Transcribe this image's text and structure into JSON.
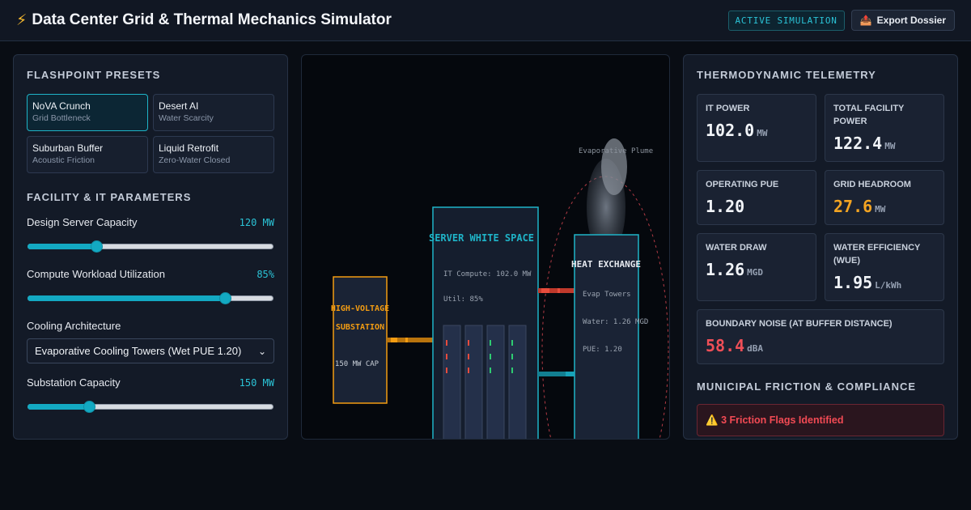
{
  "header": {
    "icon": "lightning-bolt-icon",
    "title": "Data Center Grid & Thermal Mechanics Simulator",
    "badge": "ACTIVE SIMULATION",
    "export_icon": "outbox-tray-icon",
    "export_label": "Export Dossier"
  },
  "left_panel": {
    "presets_title": "FLASHPOINT PRESETS",
    "presets": [
      {
        "name": "NoVA Crunch",
        "sub": "Grid Bottleneck",
        "active": true
      },
      {
        "name": "Desert AI",
        "sub": "Water Scarcity",
        "active": false
      },
      {
        "name": "Suburban Buffer",
        "sub": "Acoustic Friction",
        "active": false
      },
      {
        "name": "Liquid Retrofit",
        "sub": "Zero-Water Closed",
        "active": false
      }
    ],
    "params_title": "FACILITY & IT PARAMETERS",
    "params": {
      "capacity": {
        "label": "Design Server Capacity",
        "value": "120 MW",
        "level": 0.28
      },
      "utilization": {
        "label": "Compute Workload Utilization",
        "value": "85%",
        "level": 0.8
      },
      "cooling": {
        "label": "Cooling Architecture",
        "selected": "Evaporative Cooling Towers (Wet PUE 1.20)"
      },
      "substation": {
        "label": "Substation Capacity",
        "value": "150 MW",
        "level": 0.25
      }
    }
  },
  "diagram": {
    "substation": {
      "title1": "HIGH-VOLTAGE",
      "title2": "SUBSTATION",
      "cap": "150 MW CAP"
    },
    "white_space": {
      "title": "SERVER WHITE SPACE",
      "compute": "IT Compute: 102.0 MW",
      "util": "Util: 85%"
    },
    "heat_exchange": {
      "title": "HEAT EXCHANGE",
      "type": "Evap Towers",
      "water": "Water: 1.26 MGD",
      "pue": "PUE: 1.20"
    },
    "plume_label": "Evaporative Plume",
    "colors": {
      "power": "#f39c12",
      "hot": "#e74c3c",
      "cool": "#17a2b8",
      "frame": "#1fb4c8"
    }
  },
  "right_panel": {
    "telemetry_title": "THERMODYNAMIC TELEMETRY",
    "metrics": [
      {
        "label": "IT POWER",
        "value": "102.0",
        "unit": "MW",
        "status": "normal"
      },
      {
        "label": "TOTAL FACILITY POWER",
        "value": "122.4",
        "unit": "MW",
        "status": "normal"
      },
      {
        "label": "OPERATING PUE",
        "value": "1.20",
        "unit": "",
        "status": "normal"
      },
      {
        "label": "GRID HEADROOM",
        "value": "27.6",
        "unit": "MW",
        "status": "warn"
      },
      {
        "label": "WATER DRAW",
        "value": "1.26",
        "unit": "MGD",
        "status": "normal"
      },
      {
        "label": "WATER EFFICIENCY (WUE)",
        "value": "1.95",
        "unit": "L/kWh",
        "status": "normal"
      },
      {
        "label": "BOUNDARY NOISE (AT BUFFER DISTANCE)",
        "value": "58.4",
        "unit": "dBA",
        "status": "danger"
      }
    ],
    "friction_title": "MUNICIPAL FRICTION & COMPLIANCE",
    "friction_icon": "warning-icon",
    "friction_alert": "3 Friction Flags Identified"
  }
}
